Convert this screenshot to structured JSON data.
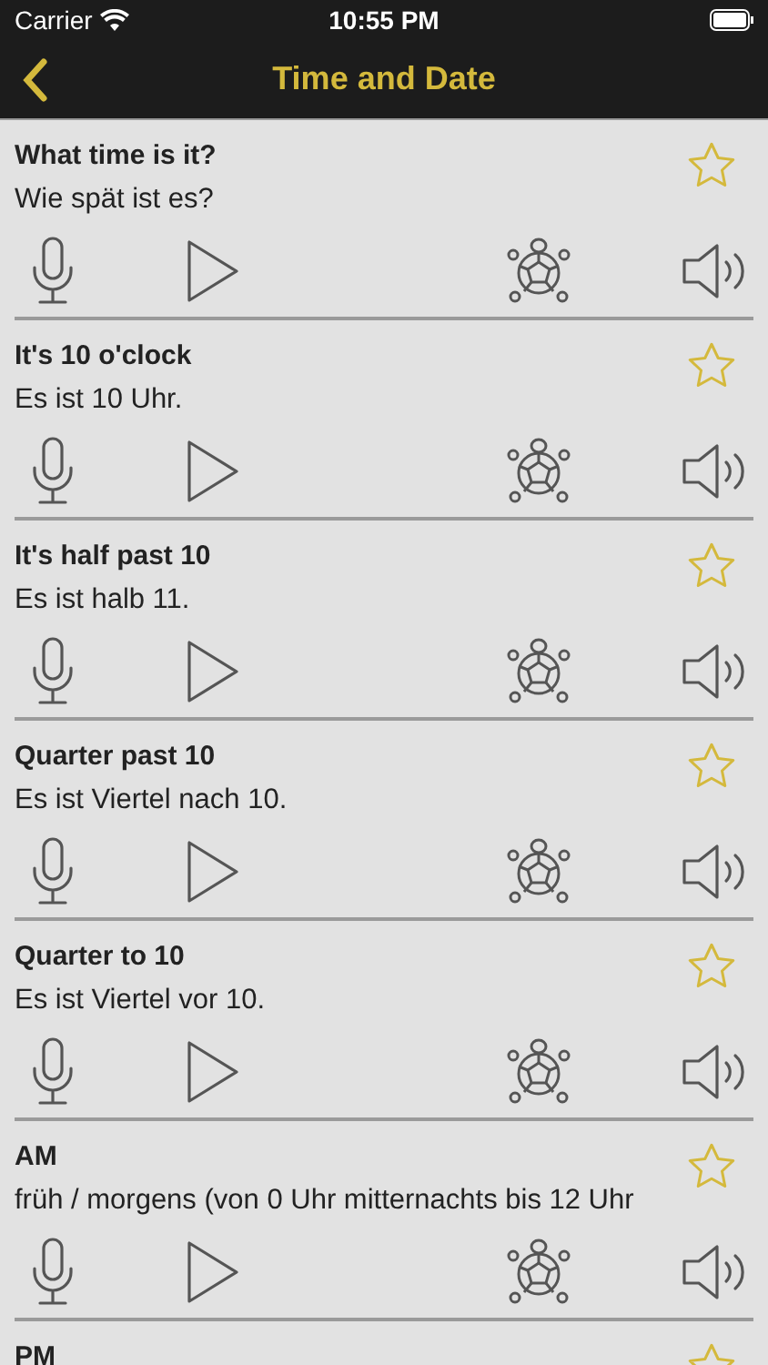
{
  "status_bar": {
    "carrier": "Carrier",
    "time": "10:55 PM"
  },
  "nav": {
    "title": "Time and Date"
  },
  "phrases": [
    {
      "english": "What time is it?",
      "german": "Wie spät ist es?",
      "starred": false
    },
    {
      "english": "It's 10 o'clock",
      "german": "Es ist 10 Uhr.",
      "starred": false
    },
    {
      "english": "It's half past 10",
      "german": "Es ist halb 11.",
      "starred": false
    },
    {
      "english": "Quarter past 10",
      "german": "Es ist Viertel nach 10.",
      "starred": false
    },
    {
      "english": "Quarter to 10",
      "german": "Es ist Viertel vor 10.",
      "starred": false
    },
    {
      "english": "AM",
      "german": "früh / morgens (von 0 Uhr mitternachts bis 12 Uhr",
      "starred": false
    },
    {
      "english": "PM",
      "starred": false
    }
  ]
}
